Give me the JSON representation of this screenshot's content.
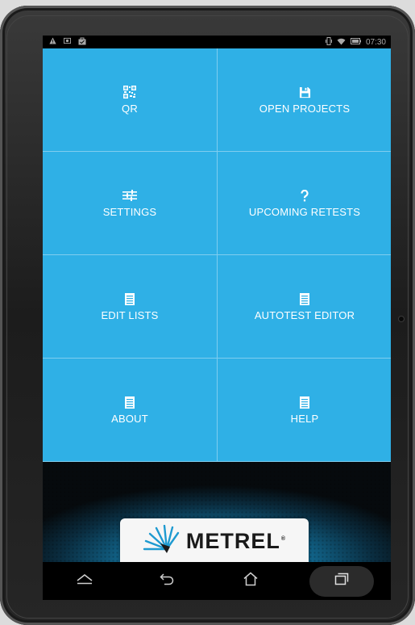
{
  "status_bar": {
    "left_icons": [
      "warning-icon",
      "image-icon",
      "bag-icon"
    ],
    "time": "07:30",
    "right_icons": [
      "vibrate-icon",
      "wifi-icon",
      "battery-icon"
    ]
  },
  "tiles": [
    {
      "label": "QR",
      "icon": "qr-code-icon"
    },
    {
      "label": "OPEN PROJECTS",
      "icon": "save-icon"
    },
    {
      "label": "SETTINGS",
      "icon": "sliders-icon"
    },
    {
      "label": "UPCOMING RETESTS",
      "icon": "question-icon"
    },
    {
      "label": "EDIT LISTS",
      "icon": "document-icon"
    },
    {
      "label": "AUTOTEST EDITOR",
      "icon": "document-icon"
    },
    {
      "label": "ABOUT",
      "icon": "document-icon"
    },
    {
      "label": "HELP",
      "icon": "document-icon"
    }
  ],
  "logo": {
    "text": "METREL",
    "registered": "®"
  },
  "nav_bar": {
    "buttons": [
      "hide-keyboard-icon",
      "back-icon",
      "home-icon",
      "recent-apps-icon"
    ]
  },
  "colors": {
    "tile": "#2fb0e6",
    "tile_divider": "#7fcdef",
    "brand_blue": "#1d93c0"
  }
}
